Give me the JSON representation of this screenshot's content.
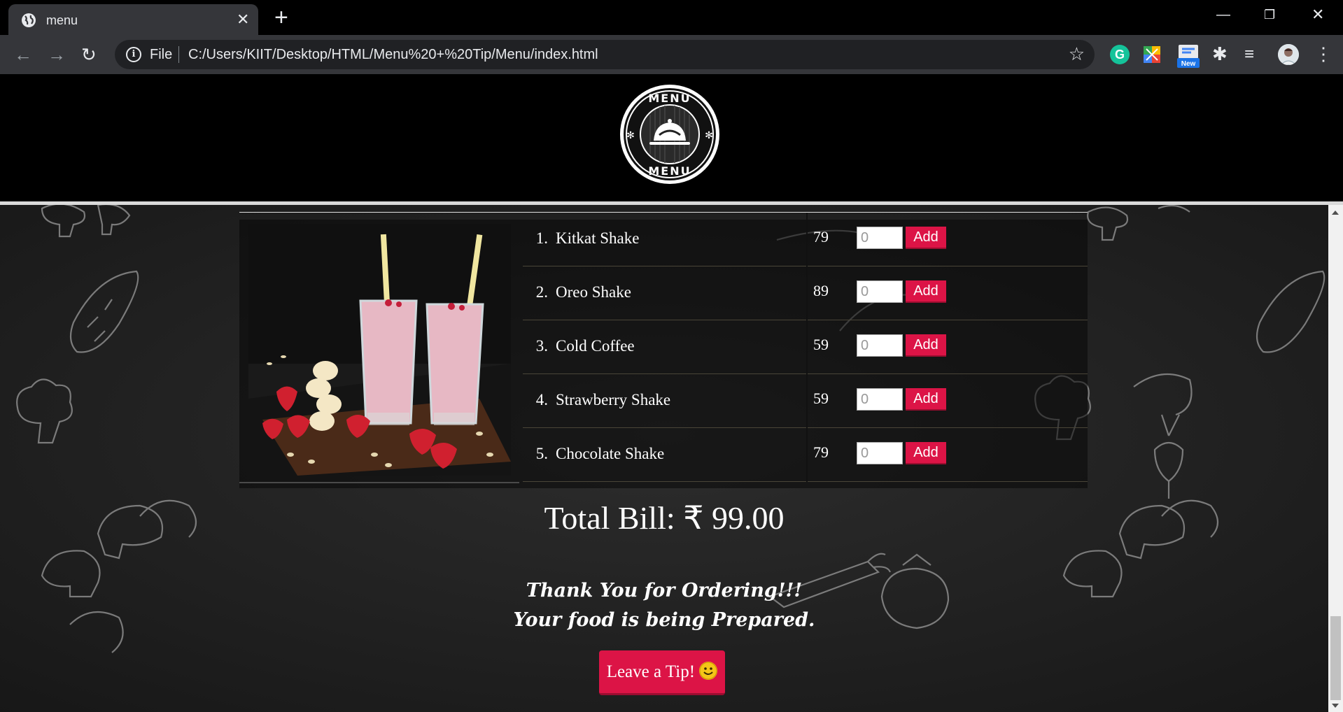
{
  "browser": {
    "tab_title": "menu",
    "address_scheme": "File",
    "address_url": "C:/Users/KIIT/Desktop/HTML/Menu%20+%20Tip/Menu/index.html",
    "extension_badge": "New"
  },
  "page": {
    "logo_top_text": "MENU",
    "logo_bottom_text": "MENU",
    "menu_items": [
      {
        "number": "1.",
        "name": "Kitkat Shake",
        "price": "79",
        "qty": "0",
        "add_label": "Add"
      },
      {
        "number": "2.",
        "name": "Oreo Shake",
        "price": "89",
        "qty": "0",
        "add_label": "Add"
      },
      {
        "number": "3.",
        "name": "Cold Coffee",
        "price": "59",
        "qty": "0",
        "add_label": "Add"
      },
      {
        "number": "4.",
        "name": "Strawberry Shake",
        "price": "59",
        "qty": "0",
        "add_label": "Add"
      },
      {
        "number": "5.",
        "name": "Chocolate Shake",
        "price": "79",
        "qty": "0",
        "add_label": "Add"
      }
    ],
    "total_bill": "Total Bill: ₹ 99.00",
    "thanks_line1": "Thank You for Ordering!!!",
    "thanks_line2": "Your food is being Prepared.",
    "tip_button": "Leave a Tip!"
  },
  "colors": {
    "accent_red": "#dc1446",
    "chalkboard": "#262626",
    "browser_toolbar": "#35363a"
  }
}
